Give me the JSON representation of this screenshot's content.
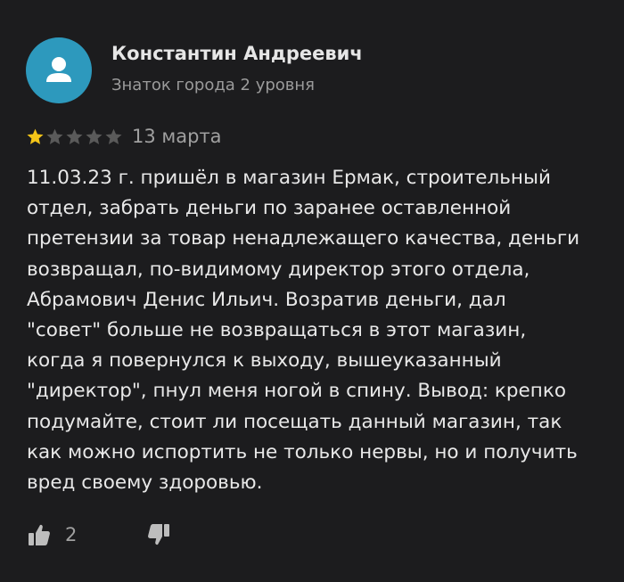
{
  "author": {
    "name": "Константин Андреевич",
    "level": "Знаток города 2 уровня",
    "avatar_icon": "user-silhouette-icon",
    "avatar_color": "#2d99bd"
  },
  "rating": {
    "value": 1,
    "max": 5,
    "filled_color": "#f5c518",
    "empty_color": "#5a5a5a"
  },
  "date": "13 марта",
  "text": "11.03.23 г. пришёл в магазин Ермак, строительный\nотдел, забрать деньги по заранее оставленной\nпретензии за товар ненадлежащего качества, деньги\nвозвращал, по-видимому директор этого отдела,\nАбрамович Денис Ильич. Возратив деньги, дал\n\"совет\" больше не возвращаться в этот магазин,\nкогда я повернулся к выходу, вышеуказанный\n\"директор\", пнул меня ногой в спину. Вывод: крепко\nподумайте, стоит ли посещать данный магазин, так\nкак можно испортить не только нервы, но и получить\nвред своему здоровью.",
  "actions": {
    "likes": "2",
    "like_icon": "thumbs-up-icon",
    "dislike_icon": "thumbs-down-icon"
  },
  "colors": {
    "background": "#1c1c1e",
    "text": "#e8e8e8",
    "secondary_text": "#9b9b9b"
  }
}
